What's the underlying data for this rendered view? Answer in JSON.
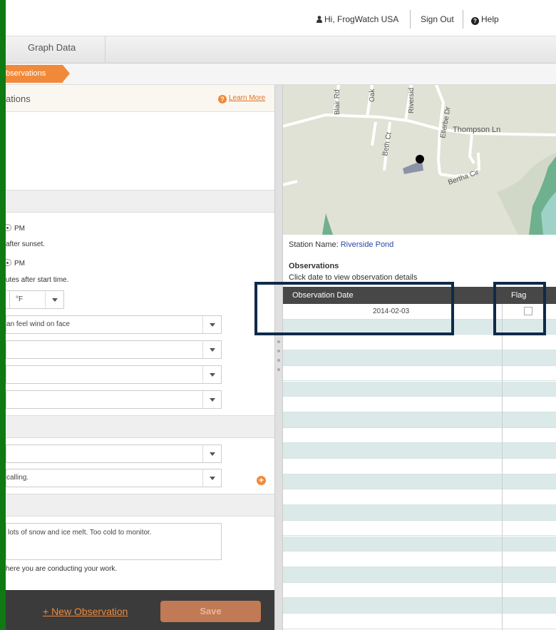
{
  "header": {
    "greeting": "Hi, FrogWatch USA",
    "sign_out": "Sign Out",
    "help": "Help"
  },
  "nav": {
    "tab_graph_data": "Graph Data"
  },
  "breadcrumb": {
    "current": "bservations"
  },
  "left": {
    "title": "ations",
    "learn_more": "Learn More",
    "am_pm_1": "PM",
    "after_sunset": "after sunset.",
    "am_pm_2": "PM",
    "after_start": "utes after start time.",
    "temp_unit": "°F",
    "wind_value": "an feel wind on face",
    "calling_value": "calling.",
    "notes_value": "lots of snow and ice melt. Too cold to monitor.",
    "location_hint": "here you are conducting your work.",
    "new_observation": "+ New Observation",
    "save": "Save"
  },
  "map": {
    "streets": [
      "Blair Rd",
      "Oak",
      "Riversid",
      "Ellerbe Dr",
      "Thompson Ln",
      "Beth Ct",
      "Bertha Cir"
    ]
  },
  "right": {
    "station_label": "Station Name:",
    "station_name": "Riverside Pond",
    "observations_title": "Observations",
    "observations_hint": "Click date to view observation details",
    "table": {
      "col_date": "Observation Date",
      "col_flag": "Flag",
      "rows": [
        {
          "date": "2014-02-03",
          "flag": false
        }
      ]
    }
  },
  "colors": {
    "accent": "#f08a3a",
    "frame": "#0f7a12",
    "table_header": "#474747",
    "row_stripe": "#dbe9e9",
    "link": "#2b45a6"
  }
}
